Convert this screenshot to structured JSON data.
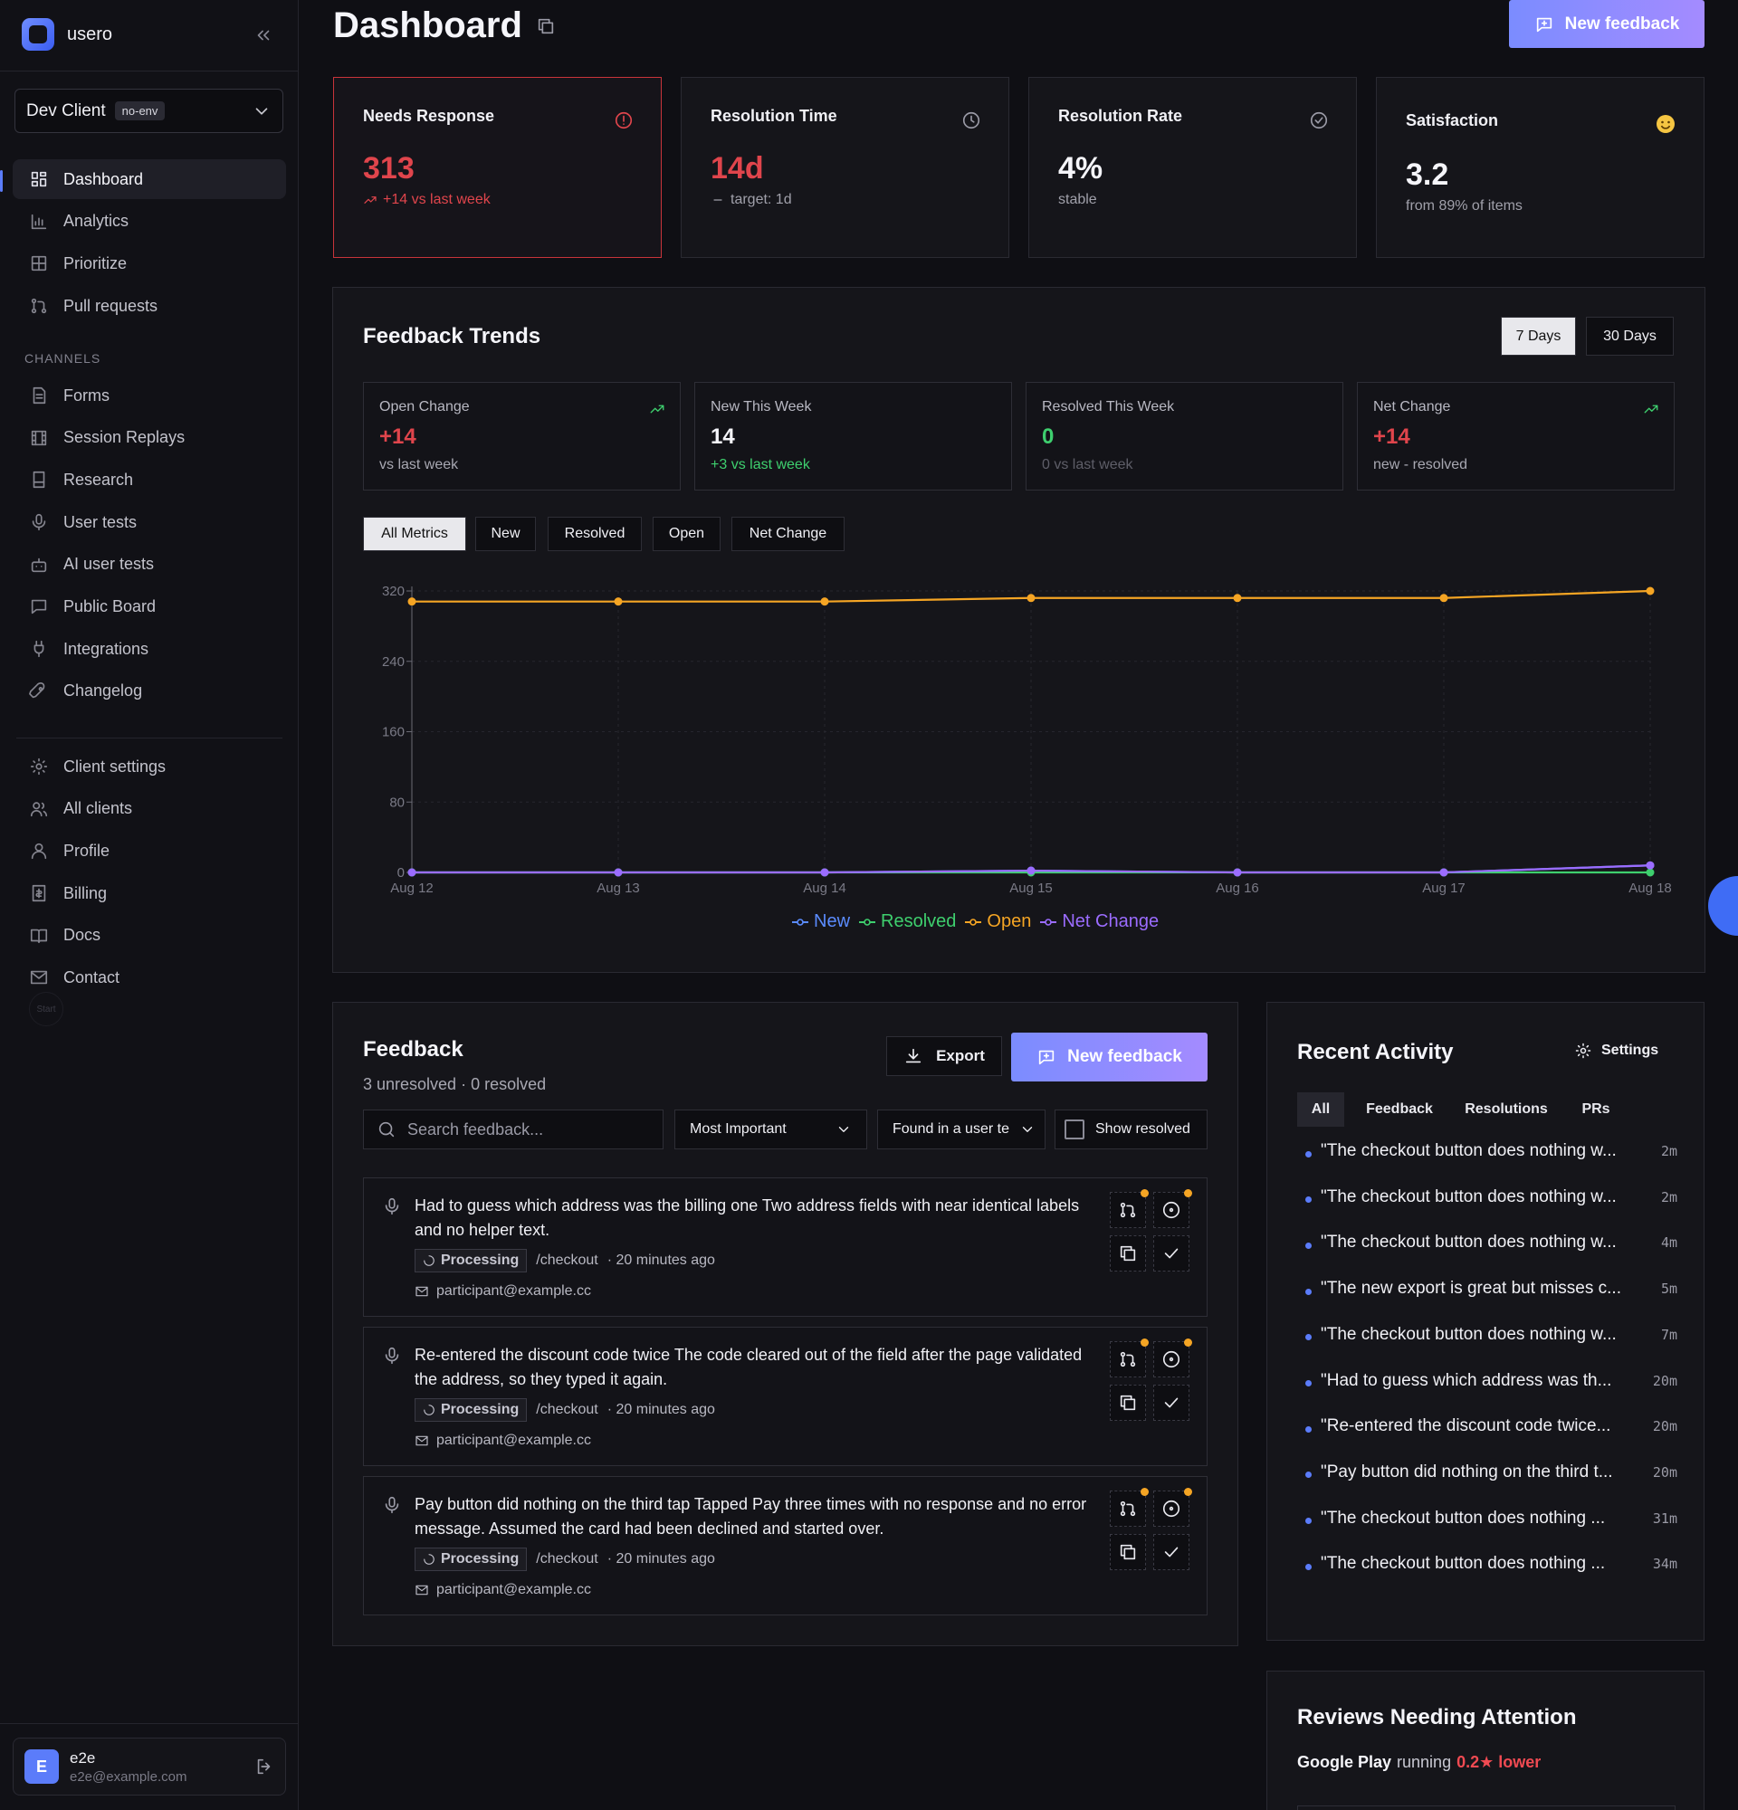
{
  "brand": {
    "name": "usero"
  },
  "client": {
    "name": "Dev Client",
    "env": "no-env"
  },
  "nav": {
    "main": [
      {
        "label": "Dashboard",
        "icon": "dashboard-icon",
        "active": true
      },
      {
        "label": "Analytics",
        "icon": "analytics-icon"
      },
      {
        "label": "Prioritize",
        "icon": "prioritize-icon"
      },
      {
        "label": "Pull requests",
        "icon": "pull-request-icon"
      }
    ],
    "channels_heading": "CHANNELS",
    "channels": [
      {
        "label": "Forms",
        "icon": "form-icon"
      },
      {
        "label": "Session Replays",
        "icon": "session-replay-icon"
      },
      {
        "label": "Research",
        "icon": "research-icon"
      },
      {
        "label": "User tests",
        "icon": "microphone-icon"
      },
      {
        "label": "AI user tests",
        "icon": "robot-icon"
      },
      {
        "label": "Public Board",
        "icon": "message-icon"
      },
      {
        "label": "Integrations",
        "icon": "plug-icon"
      },
      {
        "label": "Changelog",
        "icon": "rocket-icon"
      }
    ],
    "account": [
      {
        "label": "Client settings",
        "icon": "gear-icon"
      },
      {
        "label": "All clients",
        "icon": "users-icon"
      },
      {
        "label": "Profile",
        "icon": "user-icon"
      },
      {
        "label": "Billing",
        "icon": "billing-icon"
      },
      {
        "label": "Docs",
        "icon": "book-icon"
      },
      {
        "label": "Contact",
        "icon": "mail-icon"
      }
    ],
    "start_label": "Start"
  },
  "user": {
    "initial": "E",
    "name": "e2e",
    "email": "e2e@example.com"
  },
  "header": {
    "title": "Dashboard",
    "new_feedback_label": "New feedback"
  },
  "stats": [
    {
      "title": "Needs Response",
      "value": "313",
      "sub": "+14 vs last week",
      "icon": "alert-circle-icon"
    },
    {
      "title": "Resolution Time",
      "value": "14d",
      "sub": "target: 1d",
      "icon": "clock-icon"
    },
    {
      "title": "Resolution Rate",
      "value": "4%",
      "sub": "stable",
      "icon": "check-circle-icon"
    },
    {
      "title": "Satisfaction",
      "value": "3.2",
      "sub": "from 89% of items",
      "icon": "smiley-icon"
    }
  ],
  "trends": {
    "title": "Feedback Trends",
    "ranges": [
      "7 Days",
      "30 Days"
    ],
    "metrics": [
      {
        "label": "Open Change",
        "value": "+14",
        "sub": "vs last week"
      },
      {
        "label": "New This Week",
        "value": "14",
        "sub": "+3 vs last week"
      },
      {
        "label": "Resolved This Week",
        "value": "0",
        "sub": "0 vs last week"
      },
      {
        "label": "Net Change",
        "value": "+14",
        "sub": "new - resolved"
      }
    ],
    "filters": [
      "All Metrics",
      "New",
      "Resolved",
      "Open",
      "Net Change"
    ]
  },
  "chart_data": {
    "type": "line",
    "x": [
      "Aug 12",
      "Aug 13",
      "Aug 14",
      "Aug 15",
      "Aug 16",
      "Aug 17",
      "Aug 18"
    ],
    "ylim": [
      0,
      320
    ],
    "yticks": [
      0,
      80,
      160,
      240,
      320
    ],
    "grid": true,
    "legend": "bottom-center",
    "series": [
      {
        "name": "New",
        "color": "#5b8cff",
        "values": [
          0,
          0,
          0,
          2,
          0,
          0,
          8
        ]
      },
      {
        "name": "Resolved",
        "color": "#3ecf6e",
        "values": [
          0,
          0,
          0,
          0,
          0,
          0,
          0
        ]
      },
      {
        "name": "Open",
        "color": "#f5a524",
        "values": [
          308,
          308,
          308,
          312,
          312,
          312,
          320
        ]
      },
      {
        "name": "Net Change",
        "color": "#9b6cff",
        "values": [
          0,
          0,
          0,
          2,
          0,
          0,
          8
        ]
      }
    ]
  },
  "feedback": {
    "title": "Feedback",
    "subtitle": "3 unresolved · 0 resolved",
    "export_label": "Export",
    "new_label": "New feedback",
    "search_placeholder": "Search feedback...",
    "sort_value": "Most Important",
    "source_value": "Found in a user te",
    "show_resolved_label": "Show resolved",
    "items": [
      {
        "text": "Had to guess which address was the billing one Two address fields with near identical labels and no helper text.",
        "status": "Processing",
        "path": "/checkout",
        "time": "· 20 minutes ago",
        "email": "participant@example.cc"
      },
      {
        "text": "Re-entered the discount code twice The code cleared out of the field after the page validated the address, so they typed it again.",
        "status": "Processing",
        "path": "/checkout",
        "time": "· 20 minutes ago",
        "email": "participant@example.cc"
      },
      {
        "text": "Pay button did nothing on the third tap Tapped Pay three times with no response and no error message. Assumed the card had been declined and started over.",
        "status": "Processing",
        "path": "/checkout",
        "time": "· 20 minutes ago",
        "email": "participant@example.cc"
      }
    ]
  },
  "activity": {
    "title": "Recent Activity",
    "settings_label": "Settings",
    "tabs": [
      "All",
      "Feedback",
      "Resolutions",
      "PRs"
    ],
    "items": [
      {
        "text": "\"The checkout button does nothing w...",
        "time": "2m"
      },
      {
        "text": "\"The checkout button does nothing w...",
        "time": "2m"
      },
      {
        "text": "\"The checkout button does nothing w...",
        "time": "4m"
      },
      {
        "text": "\"The new export is great but misses c...",
        "time": "5m"
      },
      {
        "text": "\"The checkout button does nothing w...",
        "time": "7m"
      },
      {
        "text": "\"Had to guess which address was th...",
        "time": "20m"
      },
      {
        "text": "\"Re-entered the discount code twice...",
        "time": "20m"
      },
      {
        "text": "\"Pay button did nothing on the third t...",
        "time": "20m"
      },
      {
        "text": "\"The checkout button does nothing ...",
        "time": "31m"
      },
      {
        "text": "\"The checkout button does nothing ...",
        "time": "34m"
      }
    ]
  },
  "reviews": {
    "title": "Reviews Needing Attention",
    "store": "Google Play",
    "running_label": "running",
    "rating_change": "0.2★ lower"
  }
}
